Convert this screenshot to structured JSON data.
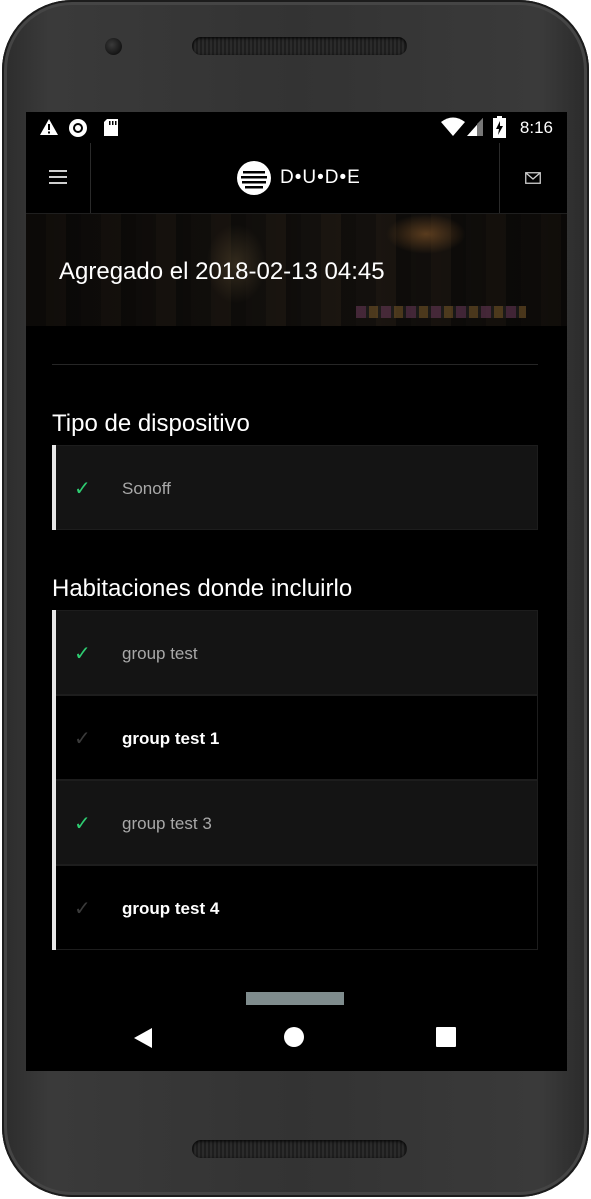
{
  "status_bar": {
    "time": "8:16",
    "left_icons": [
      "warning-icon",
      "record-icon",
      "sd-card-icon"
    ],
    "right_icons": [
      "wifi-icon",
      "signal-icon",
      "battery-charging-icon"
    ]
  },
  "app_bar": {
    "brand": "D•U•D•E",
    "menu_icon": "hamburger-icon",
    "mail_icon": "mail-icon"
  },
  "banner": {
    "title": "Agregado el 2018-02-13 04:45"
  },
  "device_type": {
    "heading": "Tipo de dispositivo",
    "items": [
      {
        "label": "Sonoff",
        "checked": true
      }
    ]
  },
  "rooms": {
    "heading": "Habitaciones donde incluirlo",
    "items": [
      {
        "label": "group test",
        "checked": true
      },
      {
        "label": "group test 1",
        "checked": false
      },
      {
        "label": "group test 3",
        "checked": true
      },
      {
        "label": "group test 4",
        "checked": false
      }
    ]
  },
  "colors": {
    "check_active": "#2ecc71",
    "accent_border": "#e8e8e8",
    "scroll_handle": "#7f8c8d"
  },
  "nav_bar": [
    "back-icon",
    "home-icon",
    "recents-icon"
  ]
}
